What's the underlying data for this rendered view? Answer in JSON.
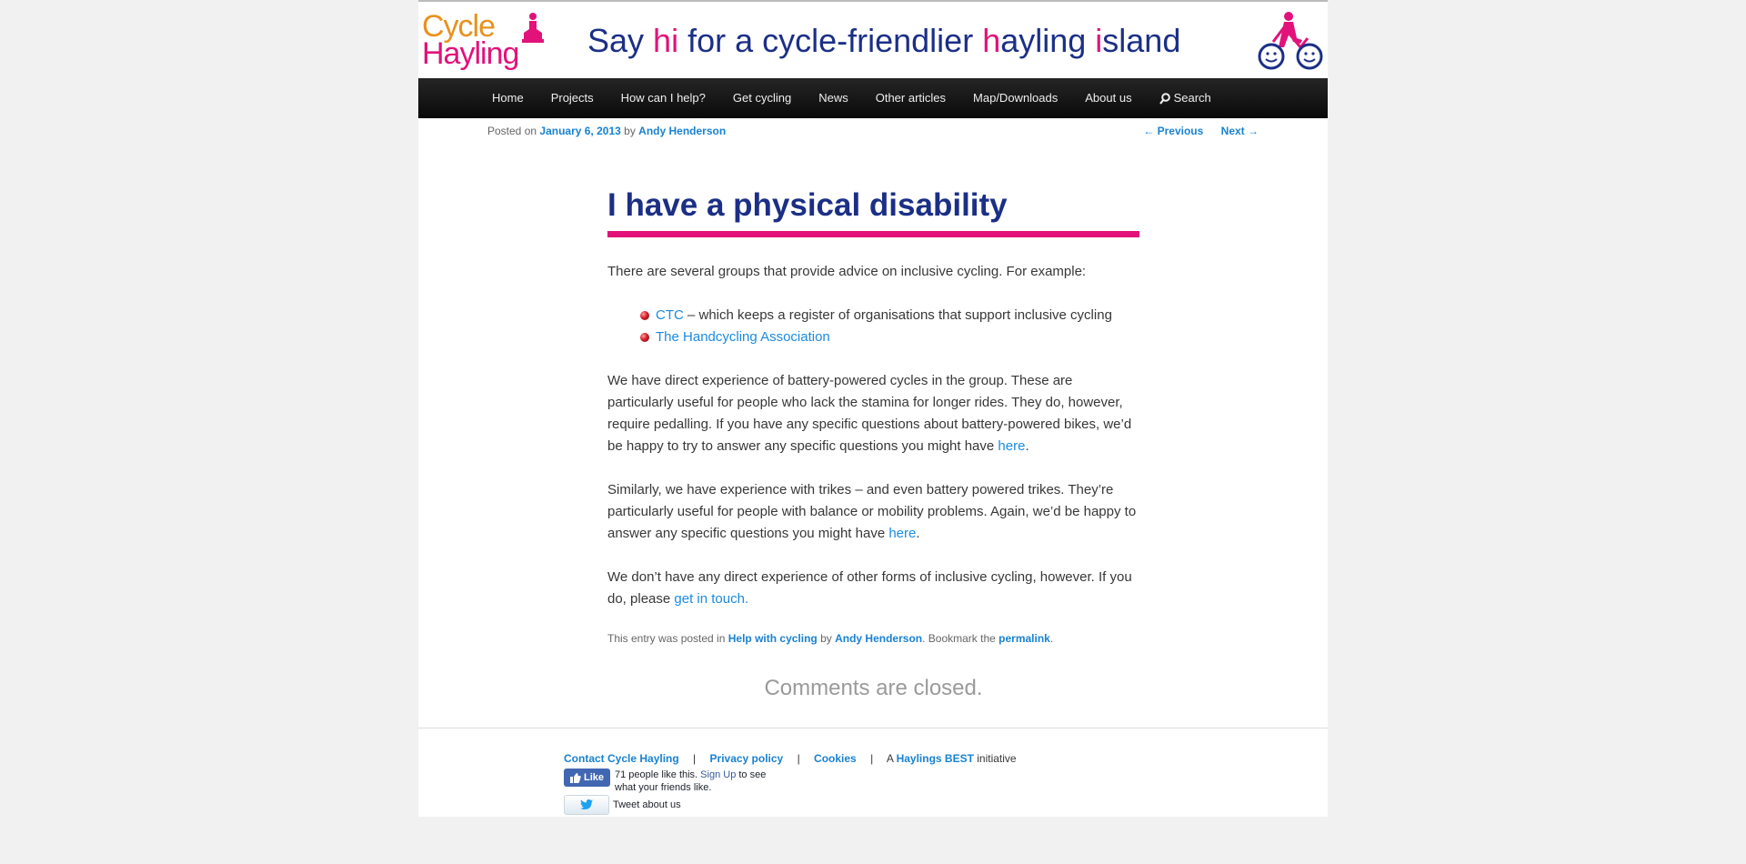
{
  "header": {
    "logo_line1": "Cycle",
    "logo_line2": "Hayling",
    "tagline_parts": [
      "Say ",
      "hi",
      " for a cycle-friendlier ",
      "h",
      "ayling ",
      "i",
      "sland"
    ],
    "accent_color": "#e2127a",
    "brand_color": "#1b2f86"
  },
  "nav": {
    "items": [
      "Home",
      "Projects",
      "How can I help?",
      "Get cycling",
      "News",
      "Other articles",
      "Map/Downloads",
      "About us"
    ],
    "search_label": "Search"
  },
  "meta": {
    "posted_on": "Posted on",
    "date": "January 6, 2013",
    "by": "by",
    "author": "Andy Henderson",
    "previous": "← Previous",
    "next": "Next →"
  },
  "article": {
    "title": "I have a physical disability",
    "intro": "There are several groups that provide advice on inclusive cycling.  For example:",
    "list": [
      {
        "link": "CTC",
        "text": " – which keeps a register of organisations that support inclusive cycling"
      },
      {
        "link": "The Handcycling Association",
        "text": ""
      }
    ],
    "p2_text": "We have direct experience of battery-powered cycles in the group.  These are particularly useful for people who lack the stamina for longer rides.  They do, however, require pedalling.  If you have any specific questions about battery-powered bikes, we’d be happy to try to answer any specific questions you might have ",
    "p2_link": "here",
    "p3_text": "Similarly, we have experience with trikes – and even battery powered trikes.  They’re particularly useful for people with balance or mobility problems.  Again, we’d be happy to answer any specific questions you might have ",
    "p3_link": "here",
    "p4_text": "We don’t have any direct experience of other forms of inclusive cycling, however.  If you do, please ",
    "p4_link": "get in touch.",
    "entry_footer": {
      "prefix": "This entry was posted in ",
      "category": "Help with cycling",
      "by": " by ",
      "author": "Andy Henderson",
      "bookmark": ". Bookmark the ",
      "permalink": "permalink",
      "end": "."
    },
    "comments_closed": "Comments are closed."
  },
  "footer": {
    "contact": "Contact Cycle Hayling",
    "privacy": "Privacy policy",
    "cookies": "Cookies",
    "separator": "|",
    "initiative_prefix": "A ",
    "initiative_link": "Haylings BEST",
    "initiative_suffix": " initiative",
    "fb_like": "Like",
    "fb_text_a": "71 people like this. ",
    "fb_signup": "Sign Up",
    "fb_text_b": " to see what your friends like.",
    "tweet_label": "Tweet about us"
  }
}
